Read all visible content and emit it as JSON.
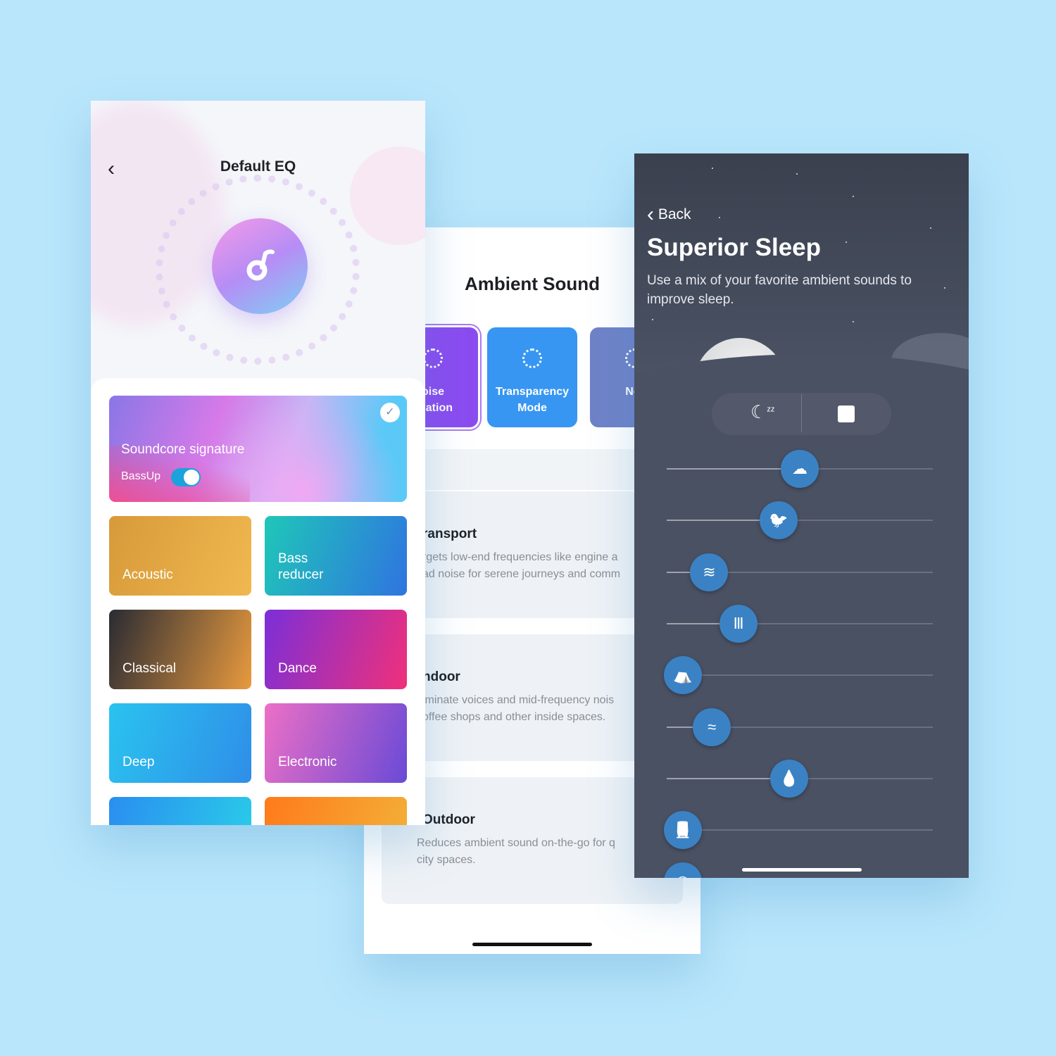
{
  "eq_screen": {
    "title": "Default EQ",
    "back_icon": "chevron-left-icon",
    "selected_preset": {
      "name": "Soundcore signature",
      "bassup_label": "BassUp",
      "bassup_on": true,
      "selected": true
    },
    "presets": [
      {
        "name": "Acoustic",
        "colors": [
          "#d79a3a",
          "#f0b84f"
        ]
      },
      {
        "name": "Bass\nreducer",
        "colors": [
          "#1fc7b8",
          "#2f74e0"
        ]
      },
      {
        "name": "Classical",
        "colors": [
          "#2a2b33",
          "#e89a3e"
        ]
      },
      {
        "name": "Dance",
        "colors": [
          "#7b2fd8",
          "#f0307a"
        ]
      },
      {
        "name": "Deep",
        "colors": [
          "#2ac3ef",
          "#2f8ee8"
        ]
      },
      {
        "name": "Electronic",
        "colors": [
          "#ec6fc6",
          "#6a4ad6"
        ]
      },
      {
        "name": "",
        "colors": [
          "#2a8ef0",
          "#2ad0e8"
        ]
      },
      {
        "name": "",
        "colors": [
          "#ff7a1a",
          "#f2b33a"
        ]
      }
    ]
  },
  "ambient_screen": {
    "title": "Ambient Sound",
    "modes": [
      {
        "label": "oise\nellation",
        "color": "#8a4cf0",
        "active": true
      },
      {
        "label": "Transparency\nMode",
        "color": "#3796f2",
        "active": false
      },
      {
        "label": "Nor",
        "color": "#6f82c8",
        "active": false
      }
    ],
    "sections": [
      {
        "title": "ransport",
        "desc": [
          "rgets low-end frequencies like engine a",
          "ad noise for serene journeys and comm"
        ]
      },
      {
        "title": "ndoor",
        "desc": [
          "iminate voices and mid-frequency nois",
          "offee shops and other inside spaces."
        ]
      },
      {
        "title": "Outdoor",
        "desc": [
          "Reduces ambient sound on-the-go for q",
          "city spaces."
        ]
      }
    ]
  },
  "sleep_screen": {
    "back_label": "Back",
    "title": "Superior Sleep",
    "subtitle": "Use a mix of your favorite ambient sounds to improve sleep.",
    "controls": {
      "sleep_timer_icon": "moon-zzz-icon",
      "stop_icon": "stop-icon"
    },
    "sounds": [
      {
        "icon": "rain-cloud-icon",
        "level": 0.5
      },
      {
        "icon": "bird-icon",
        "level": 0.42
      },
      {
        "icon": "wind-icon",
        "level": 0.16
      },
      {
        "icon": "wind-chime-icon",
        "level": 0.27
      },
      {
        "icon": "tent-icon",
        "level": 0.06
      },
      {
        "icon": "waves-icon",
        "level": 0.17
      },
      {
        "icon": "water-drop-icon",
        "level": 0.46
      },
      {
        "icon": "train-icon",
        "level": 0.06
      },
      {
        "icon": "fan-icon",
        "level": 0.06
      }
    ],
    "accent": "#3a82c4"
  }
}
